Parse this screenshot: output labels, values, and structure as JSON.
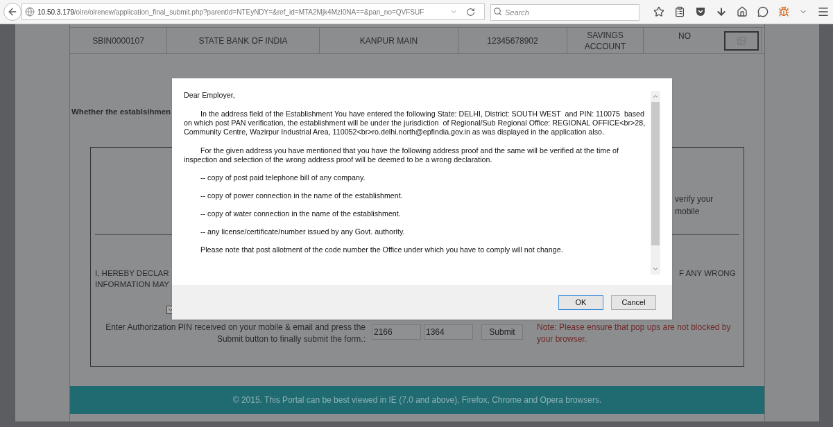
{
  "browser": {
    "url_host": "10.50.3.179",
    "url_path": "/olre/olrenew/application_final_submit.php?parentId=NTEyNDY=&ref_id=MTA2Mjk4MzI0NA==&pan_no=QVFSUF",
    "search": {
      "placeholder": "Search"
    }
  },
  "bank_table": {
    "row": [
      "SBIN0000107",
      "STATE BANK OF INDIA",
      "KANPUR MAIN",
      "12345678902",
      "SAVINGS ACCOUNT",
      "NO"
    ]
  },
  "question": "Whether the establsihmen",
  "mobile_text": "verify your mobile",
  "declaration_left": [
    "I, HEREBY DECLAR",
    "INFORMATION MAY"
  ],
  "declaration_right": "F ANY WRONG",
  "declaration_checkbox": {
    "checked": true
  },
  "pin": {
    "label": "Enter Authorization PIN received on your mobile & email and press the Submit button to finally submit the form.:",
    "values": [
      "2166",
      "1364"
    ],
    "submit": "Submit",
    "note": "Note: Please ensure that pop ups are not blocked by your browser."
  },
  "footer": "© 2015. This Portal can be best viewed in IE (7.0 and above), Firefox, Chrome and Opera browsers.",
  "dialog": {
    "greeting": "Dear Employer,",
    "paragraphs": [
      {
        "kind": "para",
        "text": "In the address field of the Establishment You have entered the following State: DELHI, District: SOUTH WEST  and PIN: 110075  based on which post PAN verification, the establishment will be under the jurisdiction  of Regional/Sub Regional Office: REGIONAL OFFICE<br>28, Community Centre, Wazirpur Industrial Area, 110052<br>ro.delhi.north@epfindia.gov.in as was displayed in the application also."
      },
      {
        "kind": "para",
        "text": "For the given address you have mentioned that you have the following address proof and the same will be verified at the time of inspection and selection of the wrong address proof will be deemed to be a wrong declaration."
      },
      {
        "kind": "item",
        "text": "-- copy of post paid telephone bill of any company."
      },
      {
        "kind": "item",
        "text": "-- copy of power connection in the name of the establishment."
      },
      {
        "kind": "item",
        "text": "-- copy of water connection in the name of the establishment."
      },
      {
        "kind": "item",
        "text": "-- any license/certificate/number issued by any Govt. authority."
      },
      {
        "kind": "item",
        "text": "Please note that post allotment of the code number the Office under which you have to comply will not change."
      }
    ],
    "buttons": [
      {
        "label": "OK",
        "selected": true
      },
      {
        "label": "Cancel",
        "selected": false
      }
    ]
  }
}
